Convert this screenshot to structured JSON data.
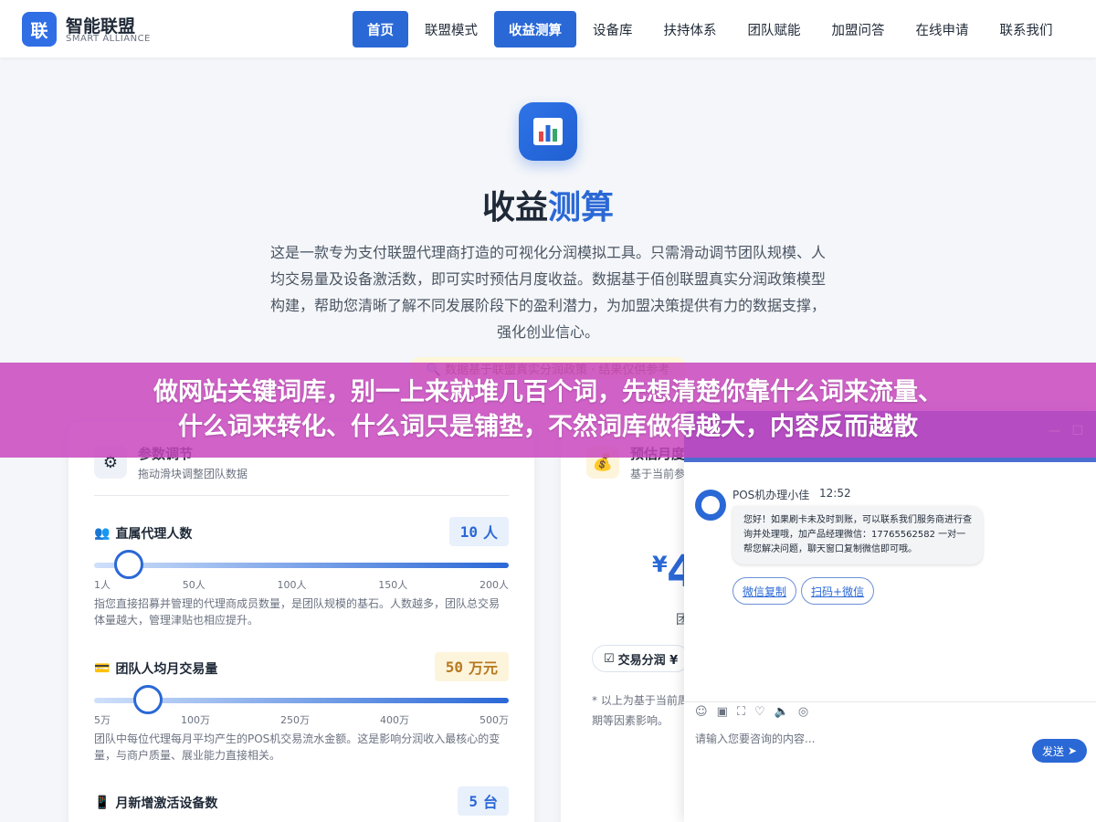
{
  "header": {
    "logo_char": "联",
    "logo_name": "智能联盟",
    "logo_sub": "SMART ALLIANCE",
    "nav": [
      {
        "label": "首页",
        "active": true
      },
      {
        "label": "联盟模式",
        "active": false
      },
      {
        "label": "收益测算",
        "active": true
      },
      {
        "label": "设备库",
        "active": false
      },
      {
        "label": "扶持体系",
        "active": false
      },
      {
        "label": "团队赋能",
        "active": false
      },
      {
        "label": "加盟问答",
        "active": false
      },
      {
        "label": "在线申请",
        "active": false
      },
      {
        "label": "联系我们",
        "active": false
      }
    ]
  },
  "hero": {
    "icon": "bar-chart-icon",
    "title_part1": "收益",
    "title_part2": "测算",
    "description": "这是一款专为支付联盟代理商打造的可视化分润模拟工具。只需滑动调节团队规模、人均交易量及设备激活数，即可实时预估月度收益。数据基于佰创联盟真实分润政策模型构建，帮助您清晰了解不同发展阶段下的盈利潜力，为加盟决策提供有力的数据支撑，强化创业信心。",
    "notice": "🔍 数据基于联盟真实分润政策 · 结果仅供参考"
  },
  "params_card": {
    "title": "参数调节",
    "subtitle": "拖动滑块调整团队数据",
    "params": [
      {
        "icon": "👥",
        "label": "直属代理人数",
        "value": "10",
        "unit": "人",
        "fraction": 0.045,
        "ticks": [
          "1人",
          "50人",
          "100人",
          "150人",
          "200人"
        ],
        "desc": "指您直接招募并管理的代理商成员数量，是团队规模的基石。人数越多，团队总交易体量越大，管理津贴也相应提升。"
      },
      {
        "icon": "💳",
        "label": "团队人均月交易量",
        "value": "50",
        "unit": "万元",
        "fraction": 0.09,
        "ticks": [
          "5万",
          "100万",
          "250万",
          "400万",
          "500万"
        ],
        "desc": "团队中每位代理每月平均产生的POS机交易流水金额。这是影响分润收入最核心的变量，与商户质量、展业能力直接相关。"
      },
      {
        "icon": "📱",
        "label": "月新增激活设备数",
        "value": "5",
        "unit": "台"
      }
    ]
  },
  "estimate_card": {
    "title": "预估月度",
    "subtitle": "基于当前参",
    "yen": "¥",
    "big": "4",
    "small": "团",
    "chip": "交易分润 ¥",
    "footnote": "* 以上为基于当前周期等因素影响。"
  },
  "chat": {
    "agent_name": "POS机办理小佳",
    "time": "12:52",
    "message": "您好！如果刷卡未及时到账，可以联系我们服务商进行查询并处理哦，加产品经理微信：17765562582 一对一帮您解决问题，聊天窗口复制微信即可哦。",
    "quick_buttons": [
      "微信复制",
      "扫码+微信"
    ],
    "placeholder": "请输入您要咨询的内容...",
    "send_label": "发送",
    "header_controls": [
      "—",
      "☐"
    ],
    "toolbar_icons": [
      "emoji-icon",
      "image-icon",
      "screenshot-icon",
      "evaluate-icon",
      "voice-icon",
      "wechat-icon"
    ]
  },
  "banner": {
    "line1": "做网站关键词库，别一上来就堆几百个词，先想清楚你靠什么词来流量、",
    "line2": "什么词来转化、什么词只是铺垫，不然词库做得越大，内容反而越散"
  },
  "colors": {
    "primary": "#2a68d6",
    "banner": "#c846be",
    "amber": "#b7791f"
  }
}
